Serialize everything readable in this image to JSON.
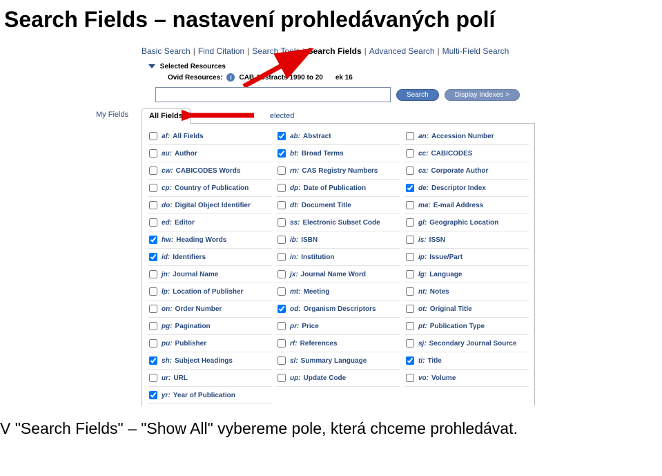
{
  "title": "Search Fields – nastavení prohledávaných polí",
  "nav": {
    "items": [
      "Basic Search",
      "Find Citation",
      "Search Tools",
      "Search Fields",
      "Advanced Search",
      "Multi-Field Search"
    ],
    "active_index": 3
  },
  "resources": {
    "header": "Selected Resources",
    "label": "Ovid Resources:",
    "value": "CAB Abstracts 1990 to 20",
    "trailing": "ek 16"
  },
  "search": {
    "button": "Search",
    "display": "Display Indexes >"
  },
  "tabs": {
    "my_fields": "My Fields",
    "all_fields": "All Fields",
    "clear_selected": "elected"
  },
  "fields": [
    {
      "code": "af",
      "label": "All Fields",
      "checked": false
    },
    {
      "code": "ab",
      "label": "Abstract",
      "checked": true
    },
    {
      "code": "an",
      "label": "Accession Number",
      "checked": false
    },
    {
      "code": "au",
      "label": "Author",
      "checked": false
    },
    {
      "code": "bt",
      "label": "Broad Terms",
      "checked": true
    },
    {
      "code": "cc",
      "label": "CABICODES",
      "checked": false
    },
    {
      "code": "cw",
      "label": "CABICODES Words",
      "checked": false
    },
    {
      "code": "rn",
      "label": "CAS Registry Numbers",
      "checked": false
    },
    {
      "code": "ca",
      "label": "Corporate Author",
      "checked": false
    },
    {
      "code": "cp",
      "label": "Country of Publication",
      "checked": false
    },
    {
      "code": "dp",
      "label": "Date of Publication",
      "checked": false
    },
    {
      "code": "de",
      "label": "Descriptor Index",
      "checked": true
    },
    {
      "code": "do",
      "label": "Digital Object Identifier",
      "checked": false
    },
    {
      "code": "dt",
      "label": "Document Title",
      "checked": false
    },
    {
      "code": "ma",
      "label": "E-mail Address",
      "checked": false
    },
    {
      "code": "ed",
      "label": "Editor",
      "checked": false
    },
    {
      "code": "ss",
      "label": "Electronic Subset Code",
      "checked": false
    },
    {
      "code": "gl",
      "label": "Geographic Location",
      "checked": false
    },
    {
      "code": "hw",
      "label": "Heading Words",
      "checked": true
    },
    {
      "code": "ib",
      "label": "ISBN",
      "checked": false
    },
    {
      "code": "is",
      "label": "ISSN",
      "checked": false
    },
    {
      "code": "id",
      "label": "Identifiers",
      "checked": true
    },
    {
      "code": "in",
      "label": "Institution",
      "checked": false
    },
    {
      "code": "ip",
      "label": "Issue/Part",
      "checked": false
    },
    {
      "code": "jn",
      "label": "Journal Name",
      "checked": false
    },
    {
      "code": "jx",
      "label": "Journal Name Word",
      "checked": false
    },
    {
      "code": "lg",
      "label": "Language",
      "checked": false
    },
    {
      "code": "lp",
      "label": "Location of Publisher",
      "checked": false
    },
    {
      "code": "mt",
      "label": "Meeting",
      "checked": false
    },
    {
      "code": "nt",
      "label": "Notes",
      "checked": false
    },
    {
      "code": "on",
      "label": "Order Number",
      "checked": false
    },
    {
      "code": "od",
      "label": "Organism Descriptors",
      "checked": true
    },
    {
      "code": "ot",
      "label": "Original Title",
      "checked": false
    },
    {
      "code": "pg",
      "label": "Pagination",
      "checked": false
    },
    {
      "code": "pr",
      "label": "Price",
      "checked": false
    },
    {
      "code": "pt",
      "label": "Publication Type",
      "checked": false
    },
    {
      "code": "pu",
      "label": "Publisher",
      "checked": false
    },
    {
      "code": "rf",
      "label": "References",
      "checked": false
    },
    {
      "code": "sj",
      "label": "Secondary Journal Source",
      "checked": false
    },
    {
      "code": "sh",
      "label": "Subject Headings",
      "checked": true
    },
    {
      "code": "sl",
      "label": "Summary Language",
      "checked": false
    },
    {
      "code": "ti",
      "label": "Title",
      "checked": true
    },
    {
      "code": "ur",
      "label": "URL",
      "checked": false
    },
    {
      "code": "up",
      "label": "Update Code",
      "checked": false
    },
    {
      "code": "vo",
      "label": "Volume",
      "checked": false
    },
    {
      "code": "yr",
      "label": "Year of Publication",
      "checked": true
    }
  ],
  "footer": "V \"Search Fields\" – \"Show All\" vybereme pole, která chceme prohledávat."
}
